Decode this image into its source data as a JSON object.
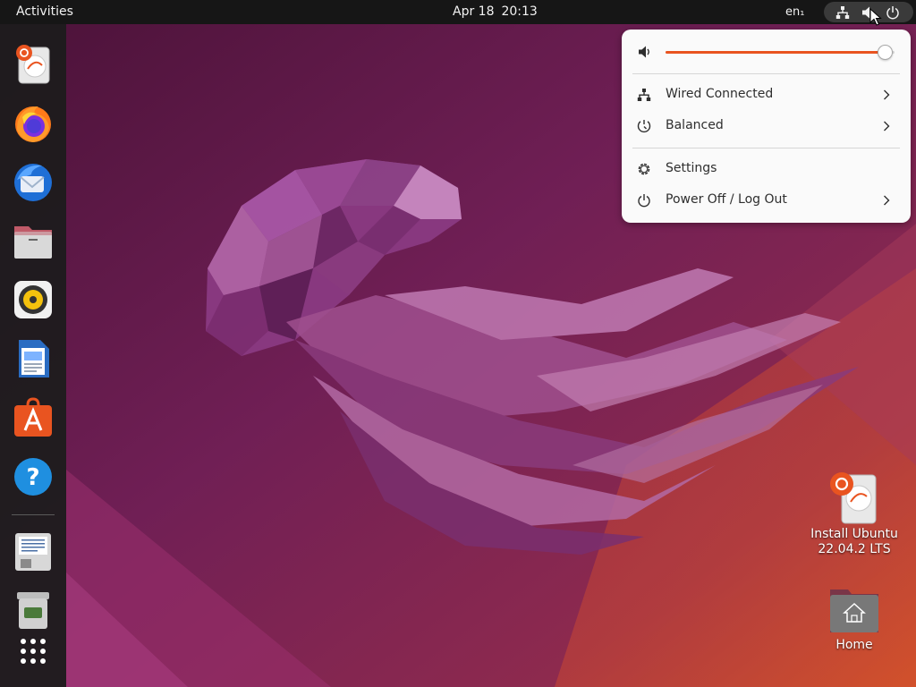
{
  "topbar": {
    "activities": "Activities",
    "date": "Apr 18",
    "time": "20:13",
    "language": "en₁"
  },
  "tray": {
    "icons": [
      "network-wired-icon",
      "volume-icon",
      "power-icon"
    ]
  },
  "quick_settings": {
    "volume_fraction": 0.99,
    "items": [
      {
        "label": "Wired Connected",
        "icon": "network-wired-icon",
        "has_arrow": true
      },
      {
        "label": "Balanced",
        "icon": "power-profile-icon",
        "has_arrow": true
      },
      {
        "label": "Settings",
        "icon": "gear-icon",
        "has_arrow": false
      },
      {
        "label": "Power Off / Log Out",
        "icon": "power-icon",
        "has_arrow": true
      }
    ]
  },
  "dock": {
    "items": [
      "install-ubuntu-icon",
      "firefox-icon",
      "thunderbird-icon",
      "files-icon",
      "rhythmbox-icon",
      "writer-icon",
      "app-center-icon",
      "help-icon",
      "text-editor-icon",
      "trash-icon",
      "app-grid-icon"
    ]
  },
  "desktop": {
    "install": {
      "line1": "Install Ubuntu",
      "line2": "22.04.2 LTS"
    },
    "home": "Home"
  },
  "colors": {
    "accent": "#e95420",
    "topbar": "#161616",
    "dock": "#1c1c1c",
    "menu_bg": "#fafafa",
    "wallpaper_base": "#6b1d52"
  }
}
